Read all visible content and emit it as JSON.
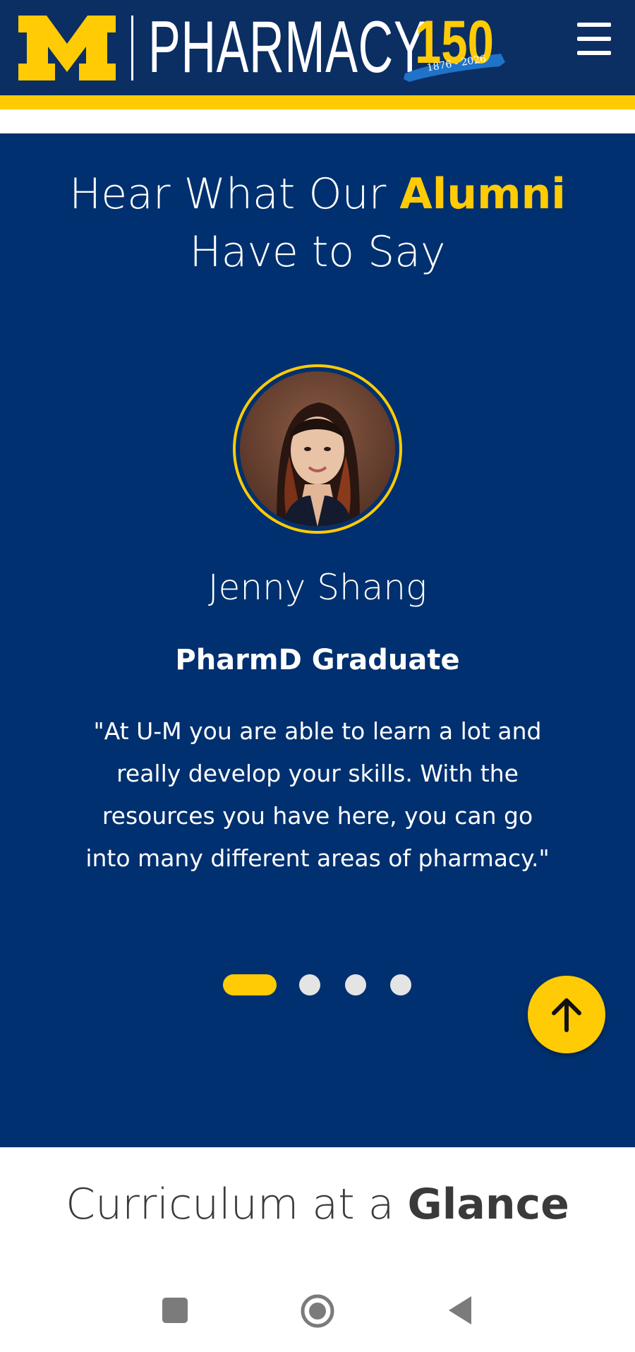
{
  "header": {
    "logo_letter": "M",
    "brand_name": "PHARMACY",
    "anniversary_number": "150",
    "anniversary_years": "1876 - 2026",
    "menu_icon": "hamburger-menu-icon"
  },
  "alumni": {
    "heading_prefix": "Hear What Our",
    "heading_accent": "Alumni",
    "heading_suffix": "Have to Say",
    "testimonial": {
      "name": "Jenny Shang",
      "role": "PharmD Graduate",
      "quote": "\"At U-M you are able to learn a lot and really develop your skills. With the resources you have here, you can go into many different areas of pharmacy.\""
    },
    "carousel": {
      "total_slides": 4,
      "active_index": 0
    },
    "back_to_top_icon": "arrow-up-icon"
  },
  "curriculum": {
    "heading_light": "Curriculum at a",
    "heading_bold": "Glance"
  },
  "system_nav": {
    "recent_icon": "square-recents-icon",
    "home_icon": "circle-home-icon",
    "back_icon": "triangle-back-icon"
  },
  "colors": {
    "maize": "#ffcb05",
    "blue": "#00306f",
    "header_blue": "#0b2e63",
    "white": "#ffffff",
    "text_dark": "#3a3a3a"
  }
}
